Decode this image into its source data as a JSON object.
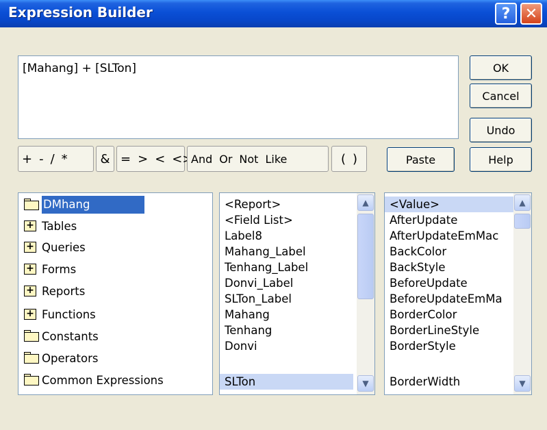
{
  "window": {
    "title": "Expression Builder",
    "help_glyph": "?",
    "close_glyph": "✕"
  },
  "expression": "[Mahang] + [SLTon]",
  "buttons": {
    "ok": "OK",
    "cancel": "Cancel",
    "undo": "Undo",
    "paste": "Paste",
    "help": "Help"
  },
  "operators": {
    "arith": [
      "+",
      "-",
      "/",
      "*"
    ],
    "concat": "&",
    "compare": [
      "=",
      ">",
      "<",
      "<>"
    ],
    "logic": [
      "And",
      "Or",
      "Not",
      "Like"
    ],
    "paren": [
      "(",
      ")"
    ]
  },
  "tree": [
    {
      "label": "DMhang",
      "icon": "open-folder-icon",
      "selected": true
    },
    {
      "label": "Tables",
      "icon": "plus-folder-icon"
    },
    {
      "label": "Queries",
      "icon": "plus-folder-icon"
    },
    {
      "label": "Forms",
      "icon": "plus-folder-icon"
    },
    {
      "label": "Reports",
      "icon": "plus-folder-icon"
    },
    {
      "label": "Functions",
      "icon": "plus-folder-icon"
    },
    {
      "label": "Constants",
      "icon": "folder-icon"
    },
    {
      "label": "Operators",
      "icon": "folder-icon"
    },
    {
      "label": "Common Expressions",
      "icon": "folder-icon"
    }
  ],
  "middle_list": [
    "<Report>",
    "<Field List>",
    "Label8",
    "Mahang_Label",
    "Tenhang_Label",
    "Donvi_Label",
    "SLTon_Label",
    "Mahang",
    "Tenhang",
    "Donvi",
    "SLTon"
  ],
  "middle_selected": "SLTon",
  "right_list": [
    "<Value>",
    "AfterUpdate",
    "AfterUpdateEmMac",
    "BackColor",
    "BackStyle",
    "BeforeUpdate",
    "BeforeUpdateEmMa",
    "BorderColor",
    "BorderLineStyle",
    "BorderStyle",
    "BorderWidth"
  ],
  "right_selected": "<Value>",
  "colors": {
    "titlebar": "#0a4fd6",
    "selection": "#316ac5",
    "dialog_bg": "#ece9d8"
  }
}
